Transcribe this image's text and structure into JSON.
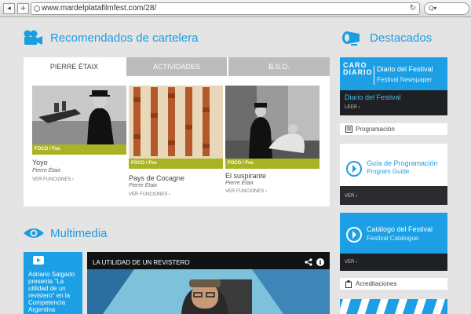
{
  "browser": {
    "back": "◂",
    "add_tab": "+",
    "url": "www.mardelplatafilmfest.com/28/",
    "reload": "↻",
    "search_icon": "Q▾"
  },
  "recomendados": {
    "title": "Recomendados de cartelera",
    "tabs": [
      "PIERRE ÉTAIX",
      "ACTIVIDADES",
      "B.S.O."
    ],
    "cards": [
      {
        "tag": "FOCO / Foc",
        "title": "Yoyo",
        "director": "Pierre Étaix",
        "more": "VER FUNCIONES ›"
      },
      {
        "tag": "FOCO / Foc",
        "title": "Pays de Cocagne",
        "director": "Pierre Étaix",
        "more": "VER FUNCIONES ›"
      },
      {
        "tag": "FOCO / Foc",
        "title": "El suspirante",
        "director": "Pierre Étaix",
        "more": "VER FUNCIONES ›"
      }
    ]
  },
  "multimedia": {
    "title": "Multimedia",
    "side_text": "Adriano Salgado presenta \"La utilidad de un revistero\" en la Competencia Argentina",
    "video_title": "LA UTILIDAD DE UN REVISTERO"
  },
  "destacados": {
    "title": "Destacados",
    "diario": {
      "logo_line1": "CARO",
      "logo_line2": "DIARIO",
      "heading": "Diario del Festival",
      "subheading": "Festival Newspaper",
      "link": "Diario del Festival",
      "action": "LEER ›"
    },
    "programacion": "Programación",
    "guia": {
      "heading": "Guía de Programación",
      "subheading": "Program Guide",
      "action": "VER ›"
    },
    "catalogo": {
      "heading": "Catálogo del Festival",
      "subheading": "Festival Catalogue",
      "action": "VER ›"
    },
    "acreditaciones": "Acreditaciones"
  },
  "colors": {
    "accent": "#1a9ee2",
    "tag": "#a8b424",
    "dark": "#1e2023"
  }
}
